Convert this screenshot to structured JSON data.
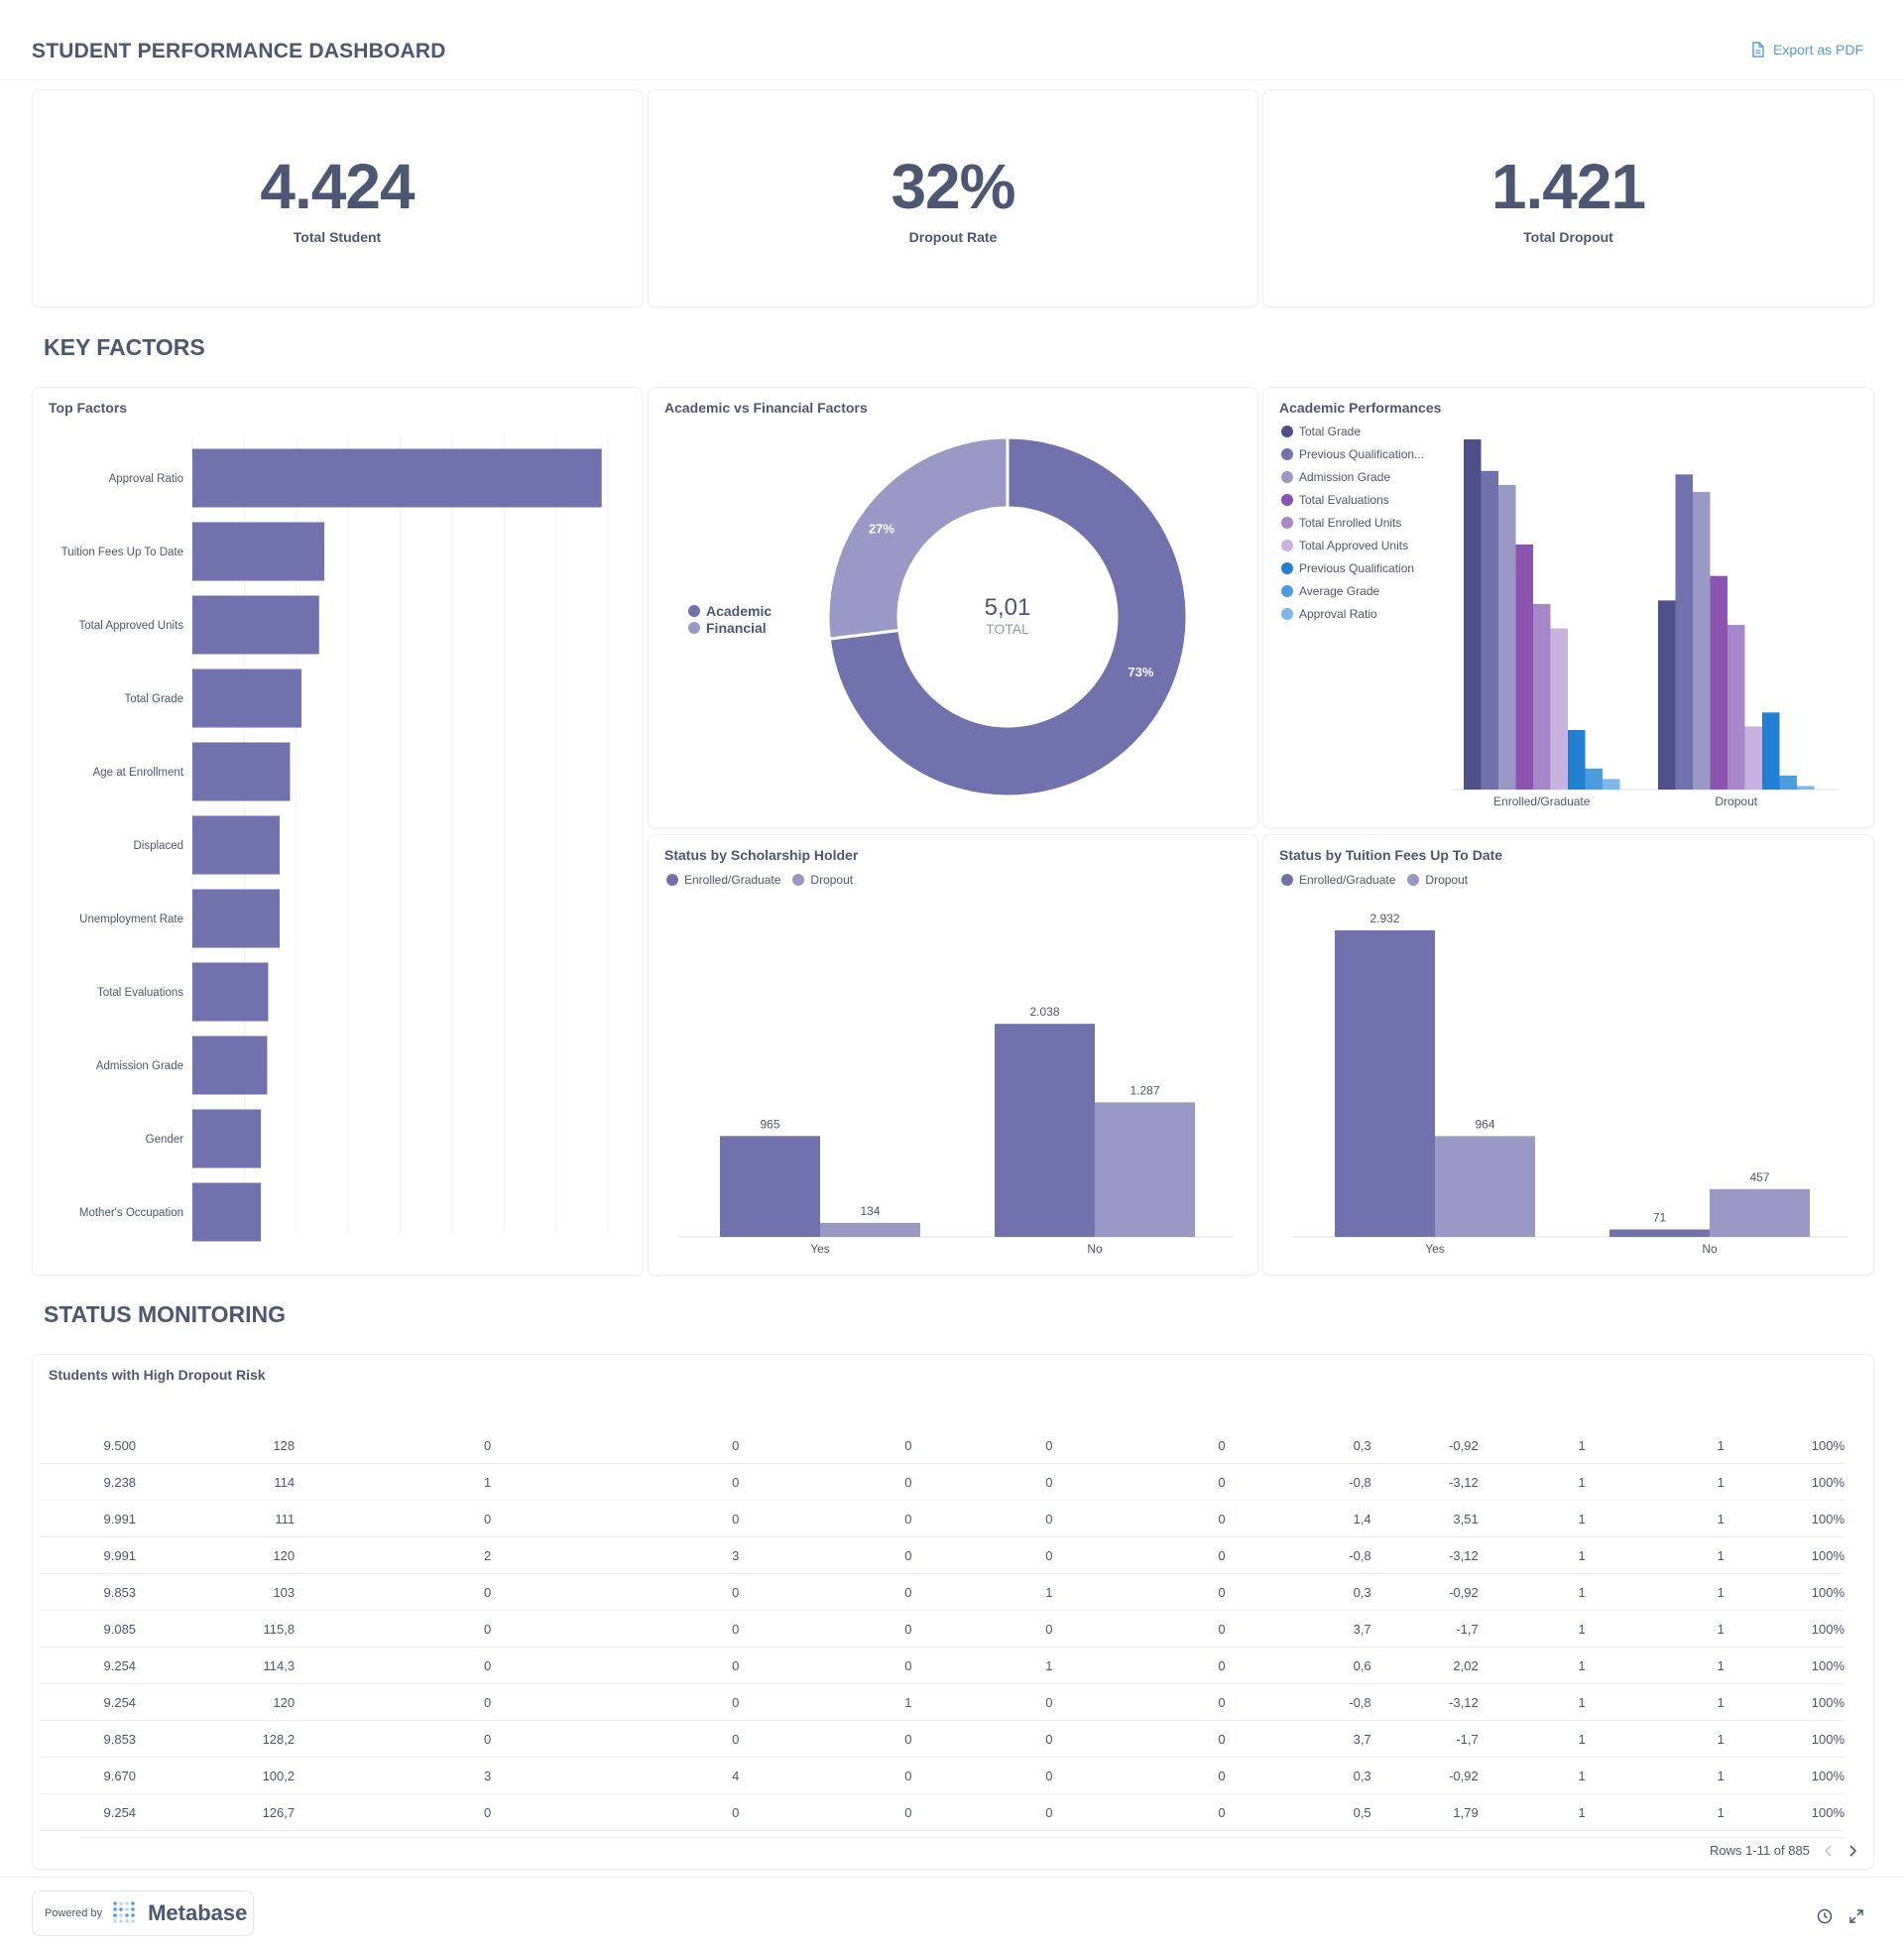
{
  "header": {
    "title": "STUDENT PERFORMANCE DASHBOARD",
    "export_label": "Export as PDF"
  },
  "kpis": [
    {
      "value": "4.424",
      "label": "Total Student"
    },
    {
      "value": "32%",
      "label": "Dropout Rate"
    },
    {
      "value": "1.421",
      "label": "Total Dropout"
    }
  ],
  "sections": {
    "key_factors": "KEY FACTORS",
    "status_monitoring": "STATUS MONITORING"
  },
  "top_factors": {
    "title": "Top Factors"
  },
  "donut": {
    "title": "Academic vs Financial Factors",
    "total": "5,01",
    "total_label": "TOTAL"
  },
  "academic_perf": {
    "title": "Academic Performances"
  },
  "scholarship": {
    "title": "Status by Scholarship Holder"
  },
  "tuition": {
    "title": "Status by Tuition Fees Up To Date"
  },
  "chart_data": [
    {
      "type": "bar",
      "orientation": "horizontal",
      "title": "Top Factors",
      "categories": [
        "Approval Ratio",
        "Tuition Fees Up To Date",
        "Total Approved Units",
        "Total Grade",
        "Age at Enrollment",
        "Displaced",
        "Unemployment Rate",
        "Total Evaluations",
        "Admission Grade",
        "Gender",
        "Mother's Occupation"
      ],
      "values": [
        0.394,
        0.127,
        0.122,
        0.105,
        0.094,
        0.084,
        0.084,
        0.073,
        0.072,
        0.066,
        0.066
      ],
      "xlim": [
        0,
        0.4
      ],
      "color": "#7172ad"
    },
    {
      "type": "pie",
      "title": "Academic vs Financial Factors",
      "categories": [
        "Academic",
        "Financial"
      ],
      "values": [
        3.66,
        1.35
      ],
      "percent_labels": [
        "73%",
        "27%"
      ],
      "colors": [
        "#7172ad",
        "#9a99c5"
      ]
    },
    {
      "type": "bar",
      "title": "Academic Performances",
      "categories": [
        "Enrolled/Graduate",
        "Dropout"
      ],
      "series": [
        {
          "name": "Total Grade",
          "values": [
            1.0,
            0.54
          ],
          "color": "#4f4f8a"
        },
        {
          "name": "Previous Qualification...",
          "values": [
            0.91,
            0.9
          ],
          "color": "#7172ad"
        },
        {
          "name": "Admission Grade",
          "values": [
            0.87,
            0.85
          ],
          "color": "#9a99c5"
        },
        {
          "name": "Total Evaluations",
          "values": [
            0.7,
            0.61
          ],
          "color": "#8b55af"
        },
        {
          "name": "Total Enrolled Units",
          "values": [
            0.53,
            0.47
          ],
          "color": "#a787c9"
        },
        {
          "name": "Total Approved Units",
          "values": [
            0.46,
            0.18
          ],
          "color": "#c9b3de"
        },
        {
          "name": "Previous Qualification",
          "values": [
            0.17,
            0.22
          ],
          "color": "#227fd2"
        },
        {
          "name": "Average Grade",
          "values": [
            0.06,
            0.04
          ],
          "color": "#4a9ee0"
        },
        {
          "name": "Approval Ratio",
          "values": [
            0.03,
            0.01
          ],
          "color": "#7db7ec"
        }
      ],
      "xlabel": "",
      "ylabel": ""
    },
    {
      "type": "bar",
      "title": "Status by Scholarship Holder",
      "categories": [
        "Yes",
        "No"
      ],
      "series": [
        {
          "name": "Enrolled/Graduate",
          "values": [
            965,
            2038
          ],
          "color": "#7172ad"
        },
        {
          "name": "Dropout",
          "values": [
            134,
            1287
          ],
          "color": "#9a99c5"
        }
      ],
      "value_labels": [
        [
          "965",
          "2.038"
        ],
        [
          "134",
          "1.287"
        ]
      ],
      "ylim": [
        0,
        2932
      ]
    },
    {
      "type": "bar",
      "title": "Status by Tuition Fees Up To Date",
      "categories": [
        "Yes",
        "No"
      ],
      "series": [
        {
          "name": "Enrolled/Graduate",
          "values": [
            2932,
            71
          ],
          "color": "#7172ad"
        },
        {
          "name": "Dropout",
          "values": [
            964,
            457
          ],
          "color": "#9a99c5"
        }
      ],
      "value_labels": [
        [
          "2.932",
          "71"
        ],
        [
          "964",
          "457"
        ]
      ],
      "ylim": [
        0,
        2932
      ]
    }
  ],
  "risk_table": {
    "title": "Students with High Dropout Risk",
    "rows": [
      [
        "9.500",
        "128",
        "0",
        "0",
        "0",
        "0",
        "0",
        "0,3",
        "-0,92",
        "1",
        "1",
        "100%"
      ],
      [
        "9.238",
        "114",
        "1",
        "0",
        "0",
        "0",
        "0",
        "-0,8",
        "-3,12",
        "1",
        "1",
        "100%"
      ],
      [
        "9.991",
        "111",
        "0",
        "0",
        "0",
        "0",
        "0",
        "1,4",
        "3,51",
        "1",
        "1",
        "100%"
      ],
      [
        "9.991",
        "120",
        "2",
        "3",
        "0",
        "0",
        "0",
        "-0,8",
        "-3,12",
        "1",
        "1",
        "100%"
      ],
      [
        "9.853",
        "103",
        "0",
        "0",
        "0",
        "1",
        "0",
        "0,3",
        "-0,92",
        "1",
        "1",
        "100%"
      ],
      [
        "9.085",
        "115,8",
        "0",
        "0",
        "0",
        "0",
        "0",
        "3,7",
        "-1,7",
        "1",
        "1",
        "100%"
      ],
      [
        "9.254",
        "114,3",
        "0",
        "0",
        "0",
        "1",
        "0",
        "0,6",
        "2,02",
        "1",
        "1",
        "100%"
      ],
      [
        "9.254",
        "120",
        "0",
        "0",
        "1",
        "0",
        "0",
        "-0,8",
        "-3,12",
        "1",
        "1",
        "100%"
      ],
      [
        "9.853",
        "128,2",
        "0",
        "0",
        "0",
        "0",
        "0",
        "3,7",
        "-1,7",
        "1",
        "1",
        "100%"
      ],
      [
        "9.670",
        "100,2",
        "3",
        "4",
        "0",
        "0",
        "0",
        "0,3",
        "-0,92",
        "1",
        "1",
        "100%"
      ],
      [
        "9.254",
        "126,7",
        "0",
        "0",
        "0",
        "0",
        "0",
        "0,5",
        "1,79",
        "1",
        "1",
        "100%"
      ]
    ],
    "pagination": "Rows 1-11 of 885"
  },
  "footer": {
    "powered_by": "Powered by",
    "brand": "Metabase"
  }
}
